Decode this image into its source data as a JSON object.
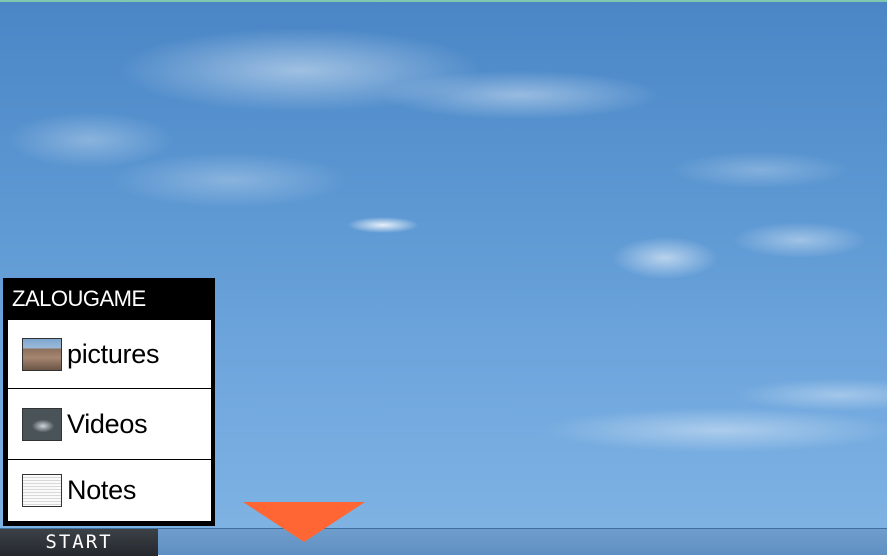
{
  "desktop": {
    "background": "sky-wallpaper"
  },
  "start_menu": {
    "title": "ZALOUGAME",
    "items": [
      {
        "label": "pictures",
        "icon": "pictures-thumbnail-icon"
      },
      {
        "label": "Videos",
        "icon": "videos-thumbnail-icon"
      },
      {
        "label": "Notes",
        "icon": "notes-thumbnail-icon"
      }
    ]
  },
  "taskbar": {
    "start_label": "START"
  },
  "pointer": {
    "icon": "orange-down-arrow-icon",
    "color": "#ff6633"
  },
  "colors": {
    "menu_bg": "#000000",
    "taskbar": "#6a98c8",
    "start_button": "#2f3439"
  }
}
